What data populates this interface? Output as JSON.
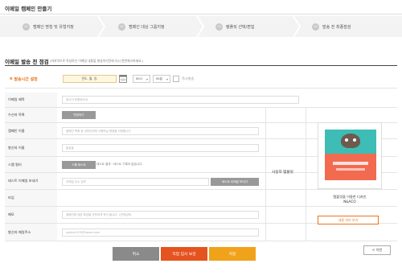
{
  "page": {
    "title": "이메일 캠페인 만들기"
  },
  "steps": [
    {
      "num": "01",
      "label": "캠페인 명칭 및 유형지정"
    },
    {
      "num": "02",
      "label": "캠페인 대상 그룹지정"
    },
    {
      "num": "03",
      "label": "템플릿 선택/편집"
    },
    {
      "num": "04",
      "label": "발송 전 최종점검"
    }
  ],
  "section": {
    "title": "이메일 발송 전 점검",
    "subtitle": "(마지막으로 작성하신 이메일 내용을 발송하기전에 다시 한번체크하세요.)"
  },
  "send_time": {
    "label": "발송시간 설정",
    "date_placeholder": "연도. 월. 일.",
    "hour": "00시",
    "minute": "00분",
    "immediate_label": "즉시발송"
  },
  "rows": {
    "subject": {
      "label": "이메일 제목",
      "placeholder": "광고이 포함되어야"
    },
    "recipients": {
      "label": "수신자 목록",
      "button": "변경하기"
    },
    "campaign_name": {
      "label": "캠페인 이름",
      "placeholder": "캠페인 목록 등 내부관리에 사용하실 명칭을 지정합니다"
    },
    "sender_name": {
      "label": "발신자 이름",
      "placeholder": "홍길동"
    },
    "spam_filter": {
      "label": "스팸 필터",
      "button": "스팸 테스트",
      "result": "테스트 결과 : 테스트 기록이 없습니다."
    },
    "test_email": {
      "label": "테스트 이메일 보내기",
      "placeholder": "이메일 주소 입력",
      "button": "테스트 이메일 보내기"
    },
    "type": {
      "label": "타입"
    },
    "memo": {
      "label": "메모",
      "placeholder": "캠페인에 대한 특징을 간략하게 적어 둡니다. (선택입력)"
    },
    "sender_email": {
      "label": "발신자 메일주소",
      "placeholder": "yoshio1070@naver.com"
    }
  },
  "template": {
    "label": "사용자 템플릿",
    "caption_line1": "템플릿을 이용한 디자인",
    "caption_line2": "N&ACO",
    "button": "내용 미리 보기"
  },
  "actions": {
    "cancel": "취소",
    "save_temp": "작업 임시 보관",
    "save": "저장",
    "prev": "< 이전"
  },
  "colors": {
    "accent_orange": "#e8751a",
    "cancel_gray": "#8a8a8a",
    "temp_red": "#e5531f",
    "save_yellow": "#f0a21b"
  }
}
